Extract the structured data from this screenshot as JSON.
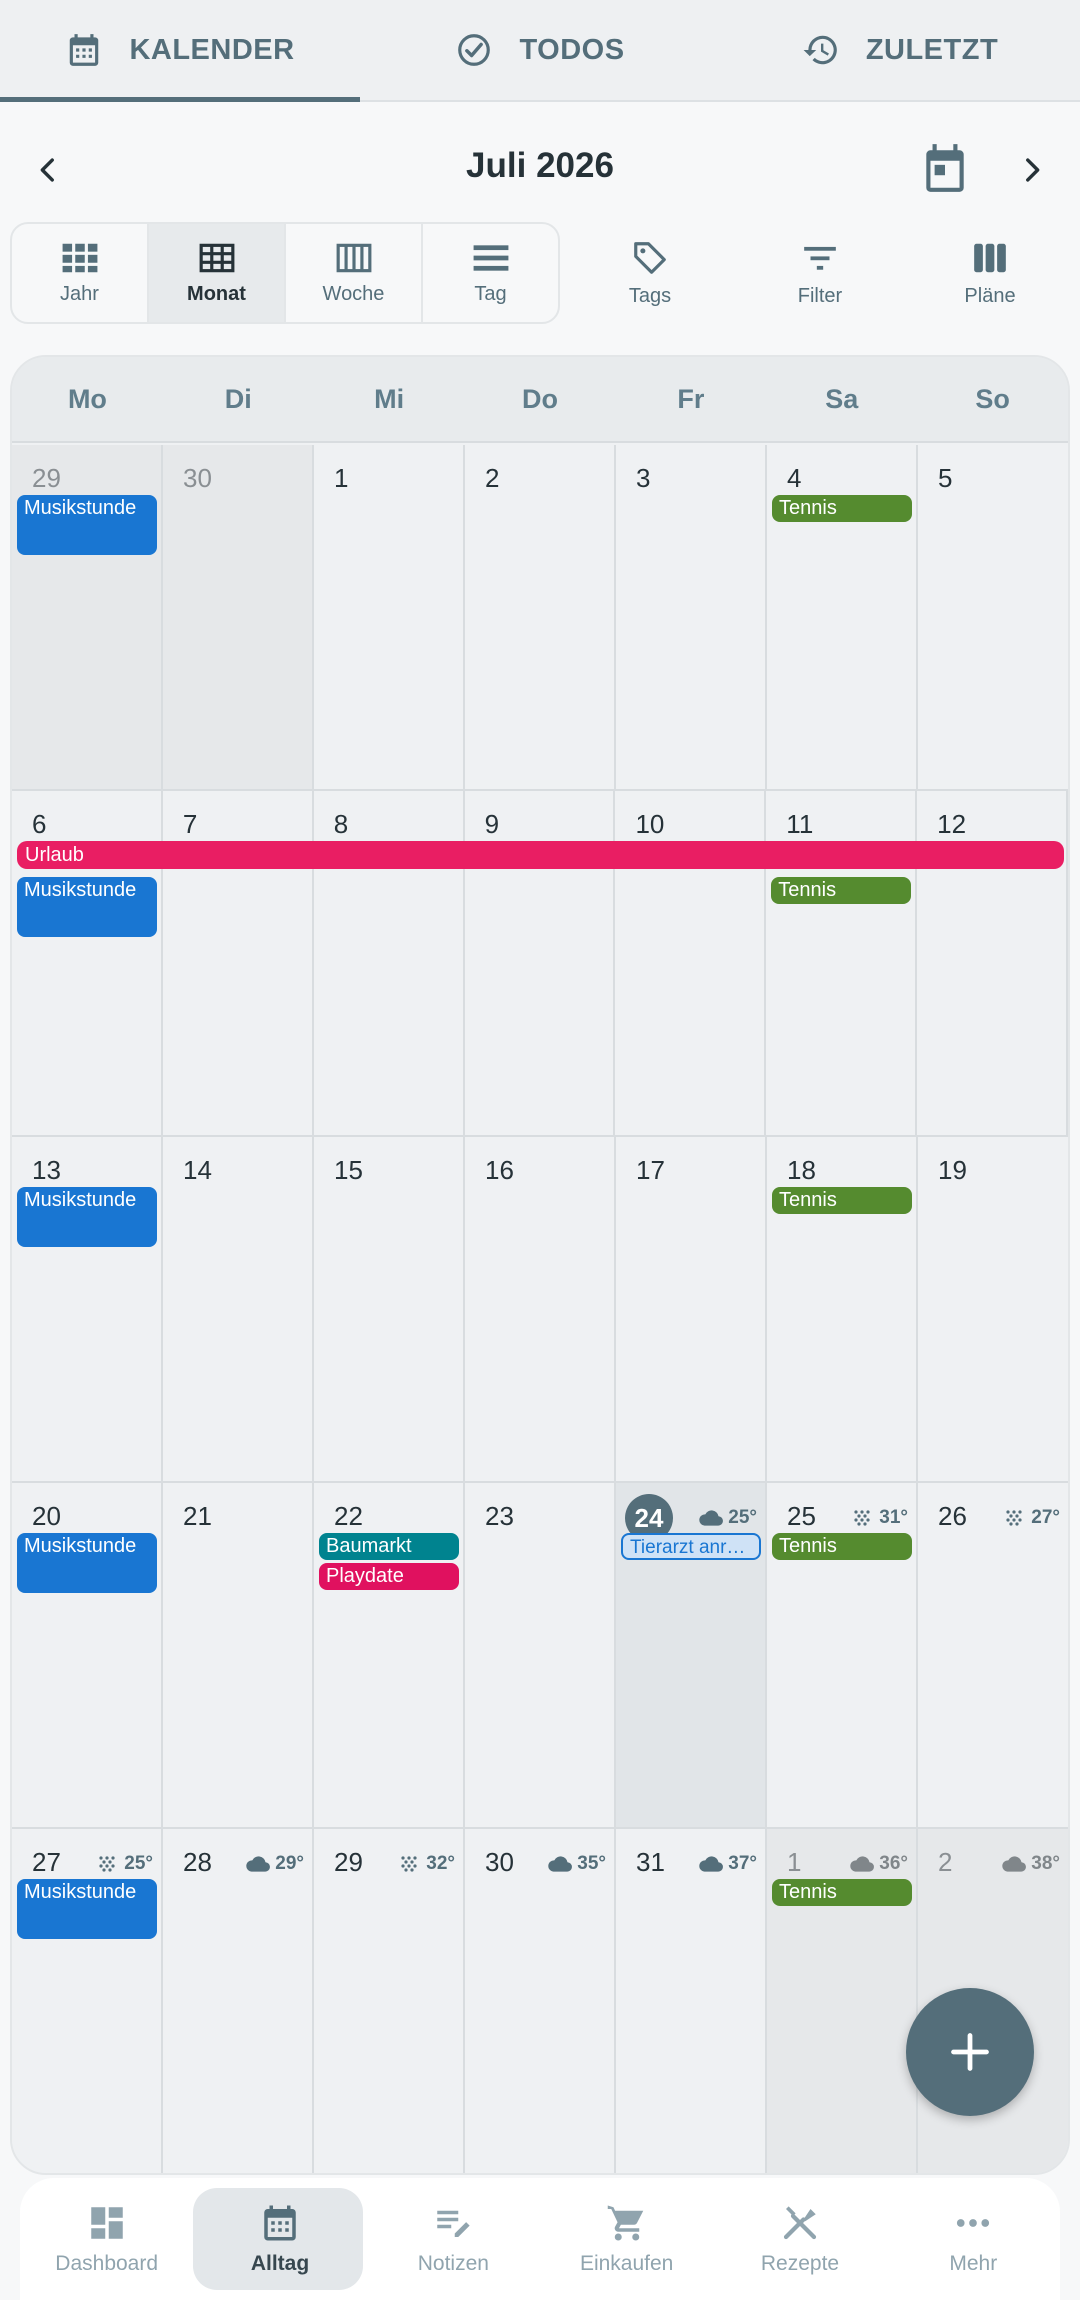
{
  "tabs": [
    {
      "label": "KALENDER",
      "icon": "calendar-icon",
      "active": true
    },
    {
      "label": "TODOS",
      "icon": "check-circle-icon",
      "active": false
    },
    {
      "label": "ZULETZT",
      "icon": "history-icon",
      "active": false
    }
  ],
  "header": {
    "month_title": "Juli 2026"
  },
  "views": [
    {
      "label": "Jahr",
      "icon": "grid-year-icon",
      "active": false
    },
    {
      "label": "Monat",
      "icon": "grid-month-icon",
      "active": true
    },
    {
      "label": "Woche",
      "icon": "week-columns-icon",
      "active": false
    },
    {
      "label": "Tag",
      "icon": "day-rows-icon",
      "active": false
    }
  ],
  "tools": [
    {
      "label": "Tags",
      "icon": "tag-icon"
    },
    {
      "label": "Filter",
      "icon": "filter-icon"
    },
    {
      "label": "Pläne",
      "icon": "plans-icon"
    }
  ],
  "weekdays": [
    "Mo",
    "Di",
    "Mi",
    "Do",
    "Fr",
    "Sa",
    "So"
  ],
  "weeks": [
    [
      {
        "num": "29",
        "out": true,
        "events": [
          {
            "title": "Musikstunde",
            "kind": "blue"
          }
        ]
      },
      {
        "num": "30",
        "out": true,
        "events": []
      },
      {
        "num": "1",
        "events": []
      },
      {
        "num": "2",
        "events": []
      },
      {
        "num": "3",
        "events": []
      },
      {
        "num": "4",
        "events": [
          {
            "title": "Tennis",
            "kind": "green"
          }
        ]
      },
      {
        "num": "5",
        "events": []
      }
    ],
    [
      {
        "num": "6",
        "events": [
          {
            "title": "Musikstunde",
            "kind": "blue"
          }
        ]
      },
      {
        "num": "7",
        "events": []
      },
      {
        "num": "8",
        "events": []
      },
      {
        "num": "9",
        "events": []
      },
      {
        "num": "10",
        "events": []
      },
      {
        "num": "11",
        "events": [
          {
            "title": "Tennis",
            "kind": "green"
          }
        ]
      },
      {
        "num": "12",
        "events": []
      }
    ],
    [
      {
        "num": "13",
        "events": [
          {
            "title": "Musikstunde",
            "kind": "blue"
          }
        ]
      },
      {
        "num": "14",
        "events": []
      },
      {
        "num": "15",
        "events": []
      },
      {
        "num": "16",
        "events": []
      },
      {
        "num": "17",
        "events": []
      },
      {
        "num": "18",
        "events": [
          {
            "title": "Tennis",
            "kind": "green"
          }
        ]
      },
      {
        "num": "19",
        "events": []
      }
    ],
    [
      {
        "num": "20",
        "events": [
          {
            "title": "Musikstunde",
            "kind": "blue"
          }
        ]
      },
      {
        "num": "21",
        "events": []
      },
      {
        "num": "22",
        "events": [
          {
            "title": "Baumarkt",
            "kind": "teal"
          },
          {
            "title": "Playdate",
            "kind": "pink"
          }
        ]
      },
      {
        "num": "23",
        "events": []
      },
      {
        "num": "24",
        "today": true,
        "weather": {
          "icon": "cloud",
          "temp": "25°"
        },
        "events": [
          {
            "title": "Tierarzt anr…",
            "kind": "outline"
          }
        ]
      },
      {
        "num": "25",
        "weather": {
          "icon": "snow",
          "temp": "31°"
        },
        "events": [
          {
            "title": "Tennis",
            "kind": "green"
          }
        ]
      },
      {
        "num": "26",
        "weather": {
          "icon": "snow",
          "temp": "27°"
        },
        "events": []
      }
    ],
    [
      {
        "num": "27",
        "weather": {
          "icon": "snow",
          "temp": "25°"
        },
        "events": [
          {
            "title": "Musikstunde",
            "kind": "blue"
          }
        ]
      },
      {
        "num": "28",
        "weather": {
          "icon": "cloud",
          "temp": "29°"
        },
        "events": []
      },
      {
        "num": "29",
        "weather": {
          "icon": "snow",
          "temp": "32°"
        },
        "events": []
      },
      {
        "num": "30",
        "weather": {
          "icon": "cloud",
          "temp": "35°"
        },
        "events": []
      },
      {
        "num": "31",
        "weather": {
          "icon": "cloud",
          "temp": "37°"
        },
        "events": []
      },
      {
        "num": "1",
        "out": true,
        "weather": {
          "icon": "cloud",
          "temp": "36°"
        },
        "events": [
          {
            "title": "Tennis",
            "kind": "green"
          }
        ]
      },
      {
        "num": "2",
        "out": true,
        "weather": {
          "icon": "cloud",
          "temp": "38°"
        },
        "events": []
      }
    ]
  ],
  "span_event": {
    "title": "Urlaub",
    "week": 1
  },
  "bottom_nav": [
    {
      "label": "Dashboard",
      "icon": "dashboard-icon",
      "active": false
    },
    {
      "label": "Alltag",
      "icon": "calendar-icon",
      "active": true
    },
    {
      "label": "Notizen",
      "icon": "notes-icon",
      "active": false
    },
    {
      "label": "Einkaufen",
      "icon": "cart-icon",
      "active": false
    },
    {
      "label": "Rezepte",
      "icon": "cutlery-icon",
      "active": false
    },
    {
      "label": "Mehr",
      "icon": "more-icon",
      "active": false
    }
  ],
  "colors": {
    "primary": "#546e7a",
    "event_blue": "#1976d2",
    "event_green": "#558b2f",
    "event_teal": "#00838f",
    "event_pink": "#e0115f",
    "span_pink": "#e91e63"
  }
}
